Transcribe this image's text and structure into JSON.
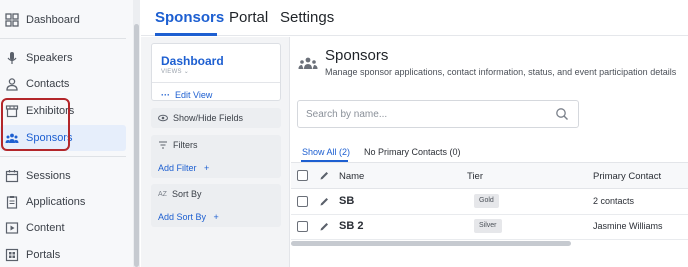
{
  "sidebar": {
    "items": [
      {
        "label": "Dashboard",
        "icon": "dashboard-icon"
      },
      {
        "label": "Speakers",
        "icon": "microphone-icon"
      },
      {
        "label": "Contacts",
        "icon": "person-icon"
      },
      {
        "label": "Exhibitors",
        "icon": "storefront-icon"
      },
      {
        "label": "Sponsors",
        "icon": "group-icon"
      },
      {
        "label": "Sessions",
        "icon": "calendar-icon"
      },
      {
        "label": "Applications",
        "icon": "clipboard-icon"
      },
      {
        "label": "Content",
        "icon": "play-icon"
      },
      {
        "label": "Portals",
        "icon": "portal-icon"
      }
    ],
    "active": "Sponsors"
  },
  "top_tabs": [
    {
      "label": "Sponsors"
    },
    {
      "label": "Portal"
    },
    {
      "label": "Settings"
    }
  ],
  "left_panel": {
    "dashboard_title": "Dashboard",
    "dashboard_sub": "VIEWS ⌄",
    "edit_view": "Edit View",
    "show_hide": "Show/Hide Fields",
    "filters": "Filters",
    "add_filter": "Add Filter",
    "sort_by": "Sort By",
    "add_sort_by": "Add Sort By"
  },
  "main": {
    "title": "Sponsors",
    "description": "Manage sponsor applications, contact information, status, and event participation details",
    "search_placeholder": "Search by name...",
    "sub_tabs": [
      {
        "label": "Show All (2)"
      },
      {
        "label": "No Primary Contacts (0)"
      }
    ],
    "columns": [
      "Name",
      "Tier",
      "Primary Contact"
    ],
    "rows": [
      {
        "name": "SB",
        "tier": "Gold",
        "contact": "2 contacts"
      },
      {
        "name": "SB 2",
        "tier": "Silver",
        "contact": "Jasmine Williams"
      }
    ]
  },
  "colors": {
    "accent": "#1d5fd1",
    "highlight": "#b3262a"
  }
}
